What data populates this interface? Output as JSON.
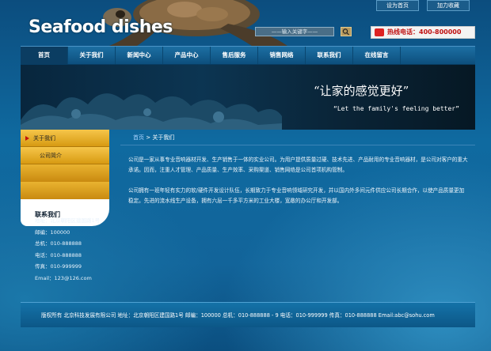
{
  "top_links": {
    "home": "设为首页",
    "fav": "加力收藏"
  },
  "logo": "Seafood dishes",
  "search": {
    "placeholder": "——输入关键字——"
  },
  "hotline": "热线电话：400-800000",
  "nav": [
    "首页",
    "关于我们",
    "新闻中心",
    "产品中心",
    "售后服务",
    "销售网络",
    "联系我们",
    "在线留言"
  ],
  "banner": {
    "slogan_cn": "“让家的感觉更好”",
    "slogan_en": "“Let the family's feeling better”"
  },
  "sidebar": {
    "items": [
      "关于我们",
      "公司简介"
    ],
    "contact_title": "联系我们"
  },
  "contact": {
    "address": "地址：北京朝阳区建国路1号",
    "zip": "邮编：100000",
    "mobile": "总机：010-888888",
    "phone": "电话：010-888888",
    "fax": "传真：010-999999",
    "email": "Email：123@126.com"
  },
  "breadcrumb": {
    "home": "首页",
    "sep": " > ",
    "current": "关于我们"
  },
  "content": [
    "公司是一家从事专业音响器材开发、生产销售于一体的实业公司。为用户提供质量过硬、技术先进、产品耐用的专业音响器材，是公司对客户的重大承诺。因而，注重人才管理、产品质量、生产效率、采购渠道、销售网络是公司首项机构管制。",
    "公司拥有一班年轻有实力的软/硬件开发设计队伍，长期致力于专业音响领域研究开发，并以国内外多间元件供应公司长期合作，以使产品质量更加稳定。先进的流水线生产设备，拥有六层一千多平方米的工业大楼，宽敞的办公厅和开发部。"
  ],
  "footer": "版权所有  北京科技发展有限公司 地址：北京朝阳区建国路1号 邮编：100000  总机：010-888888 - 9 电话：010-999999 传真：010-888888 Email:abc@sohu.com"
}
